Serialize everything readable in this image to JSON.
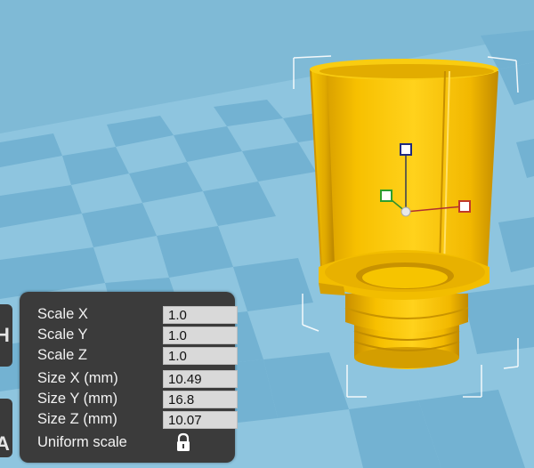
{
  "side_buttons": {
    "top_glyph": "H",
    "bottom_glyph": "A"
  },
  "scale_panel": {
    "rows": [
      {
        "label": "Scale X",
        "value": "1.0"
      },
      {
        "label": "Scale Y",
        "value": "1.0"
      },
      {
        "label": "Scale Z",
        "value": "1.0"
      },
      {
        "label": "Size X (mm)",
        "value": "10.49"
      },
      {
        "label": "Size Y (mm)",
        "value": "16.8"
      },
      {
        "label": "Size Z (mm)",
        "value": "10.07"
      }
    ],
    "uniform_scale": {
      "label": "Uniform scale",
      "icon": "lock-icon",
      "locked": true
    }
  },
  "colors": {
    "background": "#7fbad6",
    "model": "#f5c000",
    "panel": "#3b3b3b",
    "axis_x": "#c0392b",
    "axis_y": "#2e9e2e",
    "axis_z": "#1f2a80"
  }
}
